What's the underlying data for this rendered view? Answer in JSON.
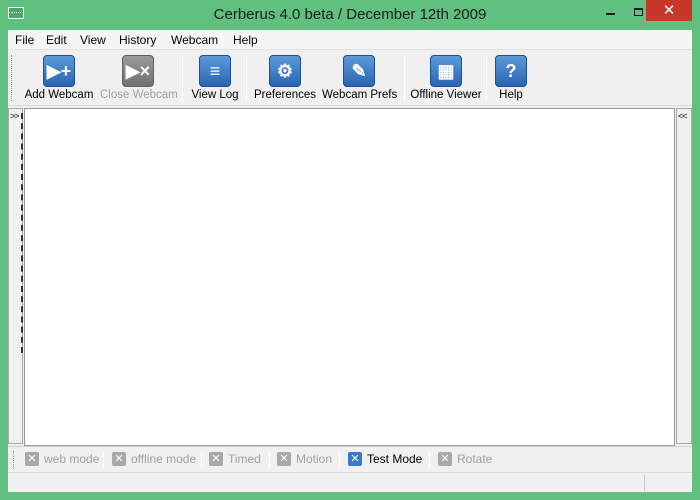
{
  "window": {
    "title": "Cerberus 4.0 beta / December 12th 2009",
    "close_glyph": "✕"
  },
  "menu": [
    {
      "label": "File"
    },
    {
      "label": "Edit"
    },
    {
      "label": "View"
    },
    {
      "label": "History"
    },
    {
      "label": "Webcam"
    },
    {
      "label": "Help"
    }
  ],
  "toolbar": {
    "buttons": [
      {
        "label": "Add Webcam",
        "icon": "add-webcam-icon",
        "glyph": "▶+",
        "enabled": true
      },
      {
        "label": "Close Webcam",
        "icon": "close-webcam-icon",
        "glyph": "▶×",
        "enabled": false
      },
      {
        "label": "View Log",
        "icon": "document-icon",
        "glyph": "≡",
        "enabled": true
      },
      {
        "label": "Preferences",
        "icon": "gear-icon",
        "glyph": "⚙",
        "enabled": true
      },
      {
        "label": "Webcam Prefs",
        "icon": "wrench-icon",
        "glyph": "✎",
        "enabled": true
      },
      {
        "label": "Offline Viewer",
        "icon": "film-icon",
        "glyph": "▦",
        "enabled": true
      },
      {
        "label": "Help",
        "icon": "help-icon",
        "glyph": "?",
        "enabled": true
      }
    ]
  },
  "side_panels": {
    "left_label": ">>",
    "right_label": "<<"
  },
  "modes": [
    {
      "label": "web mode",
      "active": false
    },
    {
      "label": "offline mode",
      "active": false
    },
    {
      "label": "Timed",
      "active": false
    },
    {
      "label": "Motion",
      "active": false
    },
    {
      "label": "Test Mode",
      "active": true
    },
    {
      "label": "Rotate",
      "active": false
    }
  ],
  "mode_box_glyph": "✕",
  "colors": {
    "titlebar": "#60c080",
    "close_button": "#c7382b",
    "icon_blue": "#2a64b4",
    "active_toggle": "#3b78c9"
  }
}
